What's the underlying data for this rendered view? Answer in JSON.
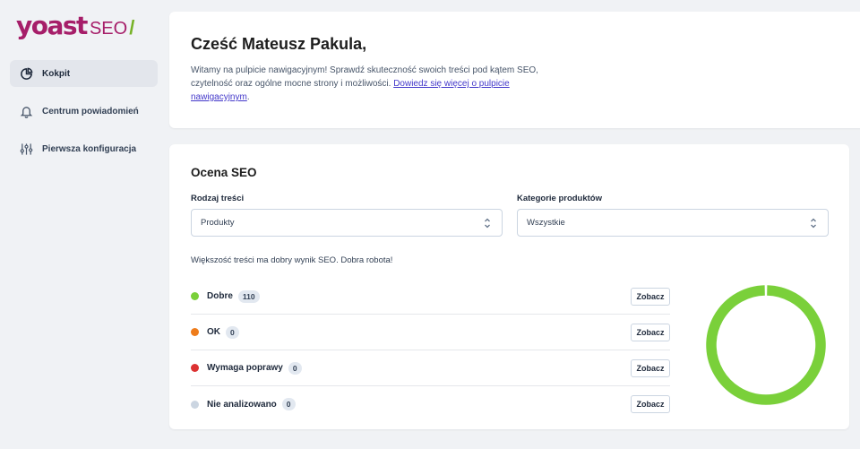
{
  "logo": {
    "brand": "yoast",
    "product": "SEO",
    "slash": "/"
  },
  "sidebar": {
    "items": [
      {
        "label": "Kokpit",
        "icon": "chart-pie-icon",
        "active": true
      },
      {
        "label": "Centrum powiadomień",
        "icon": "bell-icon",
        "active": false
      },
      {
        "label": "Pierwsza konfiguracja",
        "icon": "sliders-icon",
        "active": false
      }
    ]
  },
  "welcome": {
    "title": "Cześć Mateusz Pakula,",
    "text": "Witamy na pulpicie nawigacyjnym! Sprawdź skuteczność swoich treści pod kątem SEO, czytelność oraz ogólne mocne strony i możliwości. ",
    "link": "Dowiedz się więcej o pulpicie nawigacyjnym",
    "text_end": "."
  },
  "seo": {
    "title": "Ocena SEO",
    "content_type_label": "Rodzaj treści",
    "content_type_value": "Produkty",
    "category_label": "Kategorie produktów",
    "category_value": "Wszystkie",
    "summary": "Większość treści ma dobry wynik SEO. Dobra robota!",
    "view_label": "Zobacz",
    "scores": [
      {
        "label": "Dobre",
        "count": "110",
        "color": "#7ad03a"
      },
      {
        "label": "OK",
        "count": "0",
        "color": "#ee7c1b"
      },
      {
        "label": "Wymaga poprawy",
        "count": "0",
        "color": "#dc3232"
      },
      {
        "label": "Nie analizowano",
        "count": "0",
        "color": "#cbd5e1"
      }
    ]
  },
  "chart_data": {
    "type": "pie",
    "categories": [
      "Dobre",
      "OK",
      "Wymaga poprawy",
      "Nie analizowano"
    ],
    "values": [
      110,
      0,
      0,
      0
    ],
    "colors": [
      "#7ad03a",
      "#ee7c1b",
      "#dc3232",
      "#cbd5e1"
    ]
  }
}
